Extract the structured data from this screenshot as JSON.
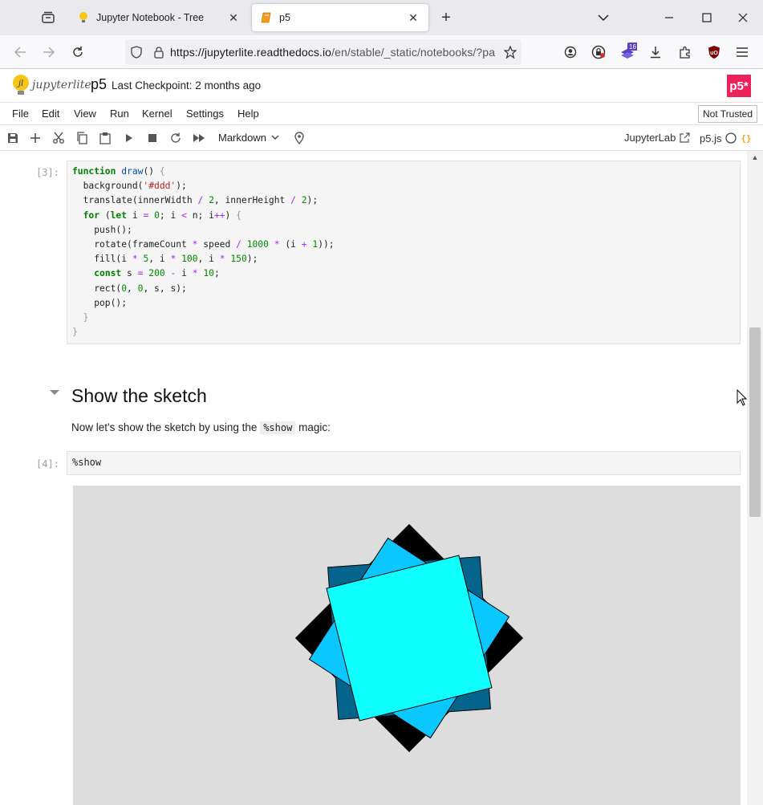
{
  "browser": {
    "tabs": [
      {
        "title": "Jupyter Notebook - Tree",
        "active": false
      },
      {
        "title": "p5",
        "active": true
      }
    ],
    "url_host": "https://jupyterlite.readthedocs.io",
    "url_path": "/en/stable/_static/notebooks/?pa",
    "extension_badge": "16"
  },
  "jupyter": {
    "logo_text": "jupyterlite",
    "notebook_name": "p5",
    "checkpoint": "Last Checkpoint: 2 months ago",
    "brand_logo": "p5*",
    "menu": [
      "File",
      "Edit",
      "View",
      "Run",
      "Kernel",
      "Settings",
      "Help"
    ],
    "trust_label": "Not Trusted",
    "cell_type": "Markdown",
    "jupyterlab_link": "JupyterLab",
    "kernel_name": "p5.js"
  },
  "cells": {
    "cell3_prompt": "[3]:",
    "cell4_prompt": "[4]:",
    "cell4_code": "%show",
    "heading": "Show the sketch",
    "md_before": "Now let's show the sketch by using the ",
    "md_code": "%show",
    "md_after": " magic:"
  },
  "colors": {
    "accent": "#ed225d",
    "sketch_bg": "#dddddd",
    "square_black": "#000000",
    "square_navy": "#05648c",
    "square_blue": "#0ac8ff",
    "square_cyan": "#0fffff"
  }
}
